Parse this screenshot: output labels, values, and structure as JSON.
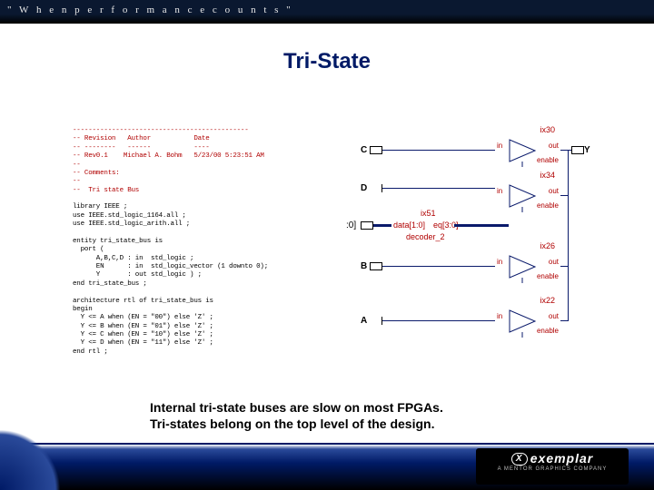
{
  "top_tagline": "\" W h e n   p e r f o r m a n c e   c o u n t s \"",
  "title": "Tri-State",
  "bullets": {
    "line1": "Internal tri-state buses are slow on most FPGAs.",
    "line2": "Tri-states belong on the top level of the design."
  },
  "logo": {
    "brand": "exemplar",
    "sub": "A  MENTOR  GRAPHICS  COMPANY"
  },
  "code_header": "---------------------------------------------\n-- Revision   Author           Date\n-- --------   ------           ----\n-- Rev0.1    Michael A. Bohm   5/23/00 5:23:51 AM\n--\n-- Comments:\n--\n--  Tri state Bus",
  "code_body": "library IEEE ;\nuse IEEE.std_logic_1164.all ;\nuse IEEE.std_logic_arith.all ;\n\nentity tri_state_bus is\n  port (\n      A,B,C,D : in  std_logic ;\n      EN      : in  std_logic_vector (1 downto 0);\n      Y       : out std_logic ) ;\nend tri_state_bus ;\n\narchitecture rtl of tri_state_bus is\nbegin\n  Y <= A when (EN = \"00\") else 'Z' ;\n  Y <= B when (EN = \"01\") else 'Z' ;\n  Y <= C when (EN = \"10\") else 'Z' ;\n  Y <= D when (EN = \"11\") else 'Z' ;\nend rtl ;",
  "signals": {
    "C": "C",
    "D": "D",
    "B": "B",
    "A": "A",
    "Y": "Y",
    "en_bus": ":0]",
    "data_lbl": "data[1:0]",
    "eq_lbl": "eq[3:0]",
    "decoder_name": "ix51",
    "decoder_type": "decoder_2"
  },
  "buffers": {
    "ix30": {
      "name": "ix30",
      "in": "in",
      "out": "out",
      "en": "enable"
    },
    "ix34": {
      "name": "ix34",
      "in": "in",
      "out": "out",
      "en": "enable"
    },
    "ix26": {
      "name": "ix26",
      "in": "in",
      "out": "out",
      "en": "enable"
    },
    "ix22": {
      "name": "ix22",
      "in": "in",
      "out": "out",
      "en": "enable"
    }
  }
}
